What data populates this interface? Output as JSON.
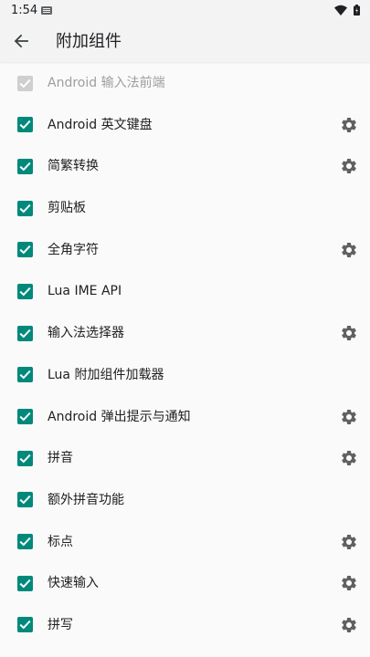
{
  "status_bar": {
    "time": "1:54"
  },
  "app_bar": {
    "title": "附加组件",
    "back_icon": "arrow-back-icon"
  },
  "colors": {
    "checked": "#00897b",
    "disabled": "#cfcfcf",
    "settings_icon": "#616161"
  },
  "preferences": [
    {
      "label": "Android 输入法前端",
      "checked": true,
      "enabled": false,
      "has_settings": false
    },
    {
      "label": "Android 英文键盘",
      "checked": true,
      "enabled": true,
      "has_settings": true
    },
    {
      "label": "简繁转换",
      "checked": true,
      "enabled": true,
      "has_settings": true
    },
    {
      "label": "剪贴板",
      "checked": true,
      "enabled": true,
      "has_settings": false
    },
    {
      "label": "全角字符",
      "checked": true,
      "enabled": true,
      "has_settings": true
    },
    {
      "label": "Lua IME API",
      "checked": true,
      "enabled": true,
      "has_settings": false
    },
    {
      "label": "输入法选择器",
      "checked": true,
      "enabled": true,
      "has_settings": true
    },
    {
      "label": "Lua 附加组件加载器",
      "checked": true,
      "enabled": true,
      "has_settings": false
    },
    {
      "label": "Android 弹出提示与通知",
      "checked": true,
      "enabled": true,
      "has_settings": true
    },
    {
      "label": "拼音",
      "checked": true,
      "enabled": true,
      "has_settings": true
    },
    {
      "label": "额外拼音功能",
      "checked": true,
      "enabled": true,
      "has_settings": false
    },
    {
      "label": "标点",
      "checked": true,
      "enabled": true,
      "has_settings": true
    },
    {
      "label": "快速输入",
      "checked": true,
      "enabled": true,
      "has_settings": true
    },
    {
      "label": "拼写",
      "checked": true,
      "enabled": true,
      "has_settings": true
    }
  ]
}
